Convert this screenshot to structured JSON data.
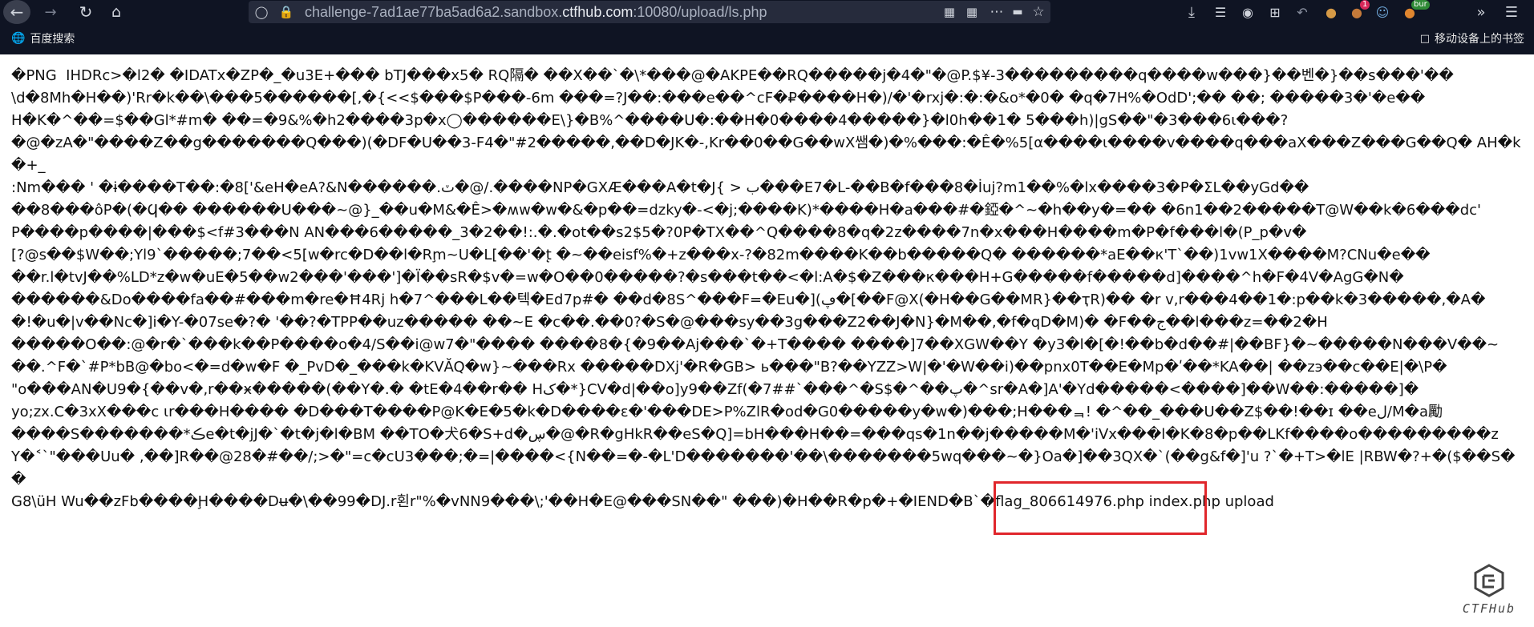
{
  "browser": {
    "url_prefix": "challenge-7ad1ae77ba5ad6a2.sandbox.",
    "url_domain": "ctfhub.com",
    "url_suffix": ":10080/upload/ls.php",
    "ext_badge_1": "1",
    "ext_badge_2": "bur"
  },
  "bookmarks": {
    "left_item": "百度搜索",
    "right_item": "移动设备上的书签"
  },
  "page": {
    "dump_text": "�PNG  IHDRc>�l2� �IDATx�ZP�_�u3E+��� bTJ���x5� RQ隔� ��X��`�\\*���@�AKPE��RQ�����j�4�\"�@P.$¥-3���������q����w���}��벤�}��s���'��\n\\d�8Mh�H��)'Rr�k��\\���5������[,�{<<$���$P���-6m ���=?J��:���e��^cF�₽����H�)/�'�rxj�:�:�&o*�0� �q�7H%�OdD';�� ��; �����3�'�e��\nH�K�^��=$��Gl*#m� ��=�9&%�h2����3p�x◯������E\\}�B%^����U�:��H�0����4�����}�l0h��1� 5���h)|gS��\"�3���6ι���?\n�@�zA�\"����Z��g�������Q���)(�DF�U��3-F4�\"#2�����,��D�JK�-,Kr��0��G��wX쌤�)�%���:�Ê�%5[α����ɩ����v����q���aX���Z���G��Q� AH�k�+_\n:Nm��� ' �ɨ����T��:�8['&eH�eA?&N������.ٽ�@/.����NP�GXӔ���A�t�J{ > ب���E7�L-��B�f���8�İuj?m1��%�lx����3�P�ΣL��yGd��\n��8���ôP�(�Ϥ�� ������U���~@}_��u�M&�Ê>�ʍw�w�&�p��=dzky�-<�j;����K)*����H�a���#�錏�^~�h��y�=�� �6n1��2�����T@W��k�6���dc'\nP����p����|���$<f#3���N AN���6�����_3�2��!:.�.�ot��s2$5�?0P�TX��^Q����8�q�2z����7n�x���H����m�P�f���l�(P_p�v�\n[?@s��$W��;Yl9`�����;7��<5[w�rc�D��l�Rm̧~U�L[��'�t̨ �~��eisf%�+z���x-?�82m����K��b�����Q� ������*aE��к'T`��)1vw1X����M?CNu�e��\n��r.l�tvJ��%LD*z�w�uE�5��w2���'���']�Ï��sR�$v�=w�O��0�����?�s���t��<�l:A�$�Z���к���H+G�����f�����d]����^h�F�4V�AgG�N�\n������&Do����fa��#���m�re�Ħ4Rj h�7^���L��텍�Ed7p#� ��d�8S^���F=�Eu�](ڥ�[��F@X(�H��G��MR}��ҭR)�� �r v,r���4��1�:p��k�3�����,�A�\n�!�u�|v��Nc�]i�Y-�07se�?� '��?�TPP��uz����� ��~E �c��.��0?�S�@���sy��3g���Z2��J�N}�M��,�f�qD�M)� �F��ج��l���z=��2�H\n�����O��:@�r�`���k��P����o�4/S��i@w7�\"���� ����8�{�9��Aj���`�+T���� ����]7��XGW��Y �y3�l�[�!��b�d��#|��BF}�~�����N���V��~\n��.^F�`#P*bB@�bo<�=d�w�F �_PvD�_���k�KVĂQ�w}~���Rx �����DXj'�R�GB> ь���\"B?��YZZ>W|�'�W��i)��pnx0T��E�Mp�ʹ��*KA��| ��zэ��c��E|�\\P�\n\"o���AN�U9�{��v�,r��ӿ�����(��Y�.� �tE�4��r�� Hک�*}CV�d|��o]y9��Zf(�7##`���^�S$�^��پ�^sr�A�]A'�Yd�����<����]��W��:�����]�\nyo;zx.C�3xX���c ɩr���H���� �D���T����P@K�E�5�k�D����ɛ�'���DE>P%ZlR�od�G0�����y�w�)���;H���ᆿ! �^��_���U��Z$��!��ɪ ��eل/M�a勵\n����S�������*ڪe�t�jJ�`�t�j�l�BM ��TO�犬6�S+d�ڛ�@�R�gHkR��eS�Q]=bH���H��=���qs�1n��j�����M�'iVx���l�K�8�p��LKf����o���������z\nY�˂`\"���Uu� ,��]R��@28�#��/;>�\"=c�cU3���;�=|����<{N��=�-�L'D�������'��\\�������5wq���~�}Oa�]��3QX�`(��g&f�]'u ?`�+T>�lE |RBW�?+�($��S��\nG8\\üH Wu��zFb����Ḩ����Dʉ�\\��99�DJ.r횐r\"%�vNN9���\\;'��H�E@���SN��\" ���)�H��R�p�+�IEND�B`�flag_806614976.php index.php upload"
  },
  "watermark": {
    "text": "CTFHub"
  }
}
